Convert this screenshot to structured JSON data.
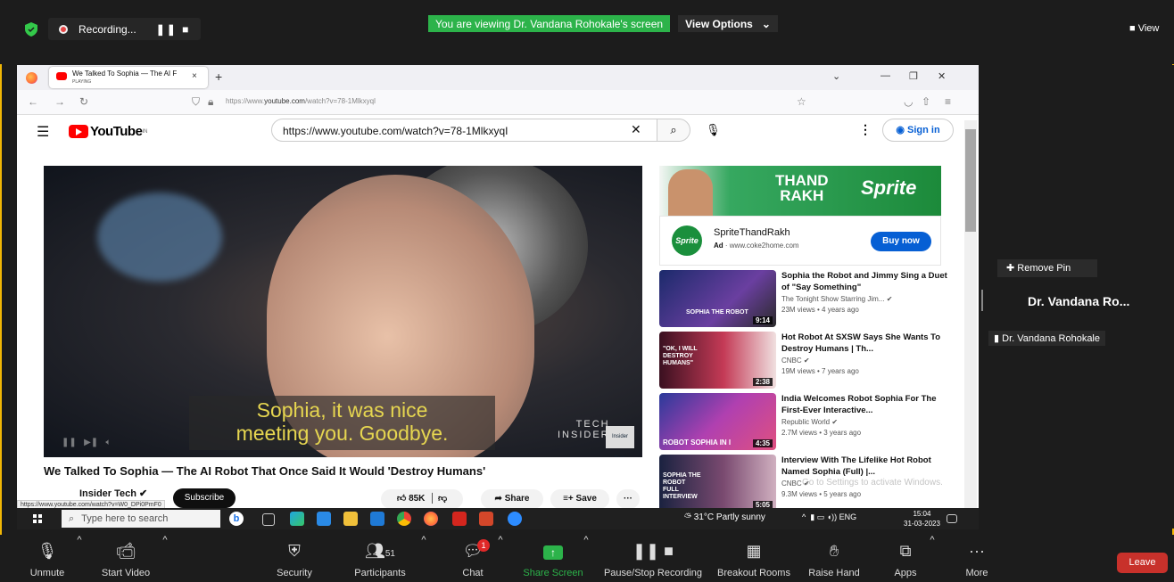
{
  "zoom_top": {
    "recording_label": "Recording...",
    "recording_controls": "❚❚  ■",
    "viewing_banner": "You are viewing Dr. Vandana Rohokale's screen",
    "view_options": "View Options",
    "view_options_caret": "⌄",
    "view_button": "View"
  },
  "browser": {
    "tab_title": "We Talked To Sophia — The AI F",
    "tab_status": "PLAYING",
    "tab_close": "×",
    "new_tab": "+",
    "url_prefix": "https://www.",
    "url_domain": "youtube.com",
    "url_path": "/watch?v=78-1Mlkxyql",
    "status_url": "https://www.youtube.com/watch?v=W0_DPi0PmF0"
  },
  "youtube": {
    "logo_text": "YouTube",
    "logo_region": "IN",
    "search_value": "https://www.youtube.com/watch?v=78-1MlkxyqI",
    "sign_in": "Sign in",
    "caption_line1": "Sophia, it was nice",
    "caption_line2": "meeting you. Goodbye.",
    "tech_insider": "TECH\nINSIDER",
    "insider_logo": "Insider Tech",
    "video_title": "We Talked To Sophia — The AI Robot That Once Said It Would 'Destroy Humans'",
    "channel_name": "Insider Tech",
    "subscribe": "Subscribe",
    "likes": "85K",
    "share": "Share",
    "save": "Save",
    "more": "···"
  },
  "ad": {
    "banner_line1": "THAND",
    "banner_line2": "RAKH",
    "banner_brand": "Sprite",
    "logo": "Sprite",
    "name": "SpriteThandRakh",
    "ad_label": "Ad",
    "url": "www.coke2home.com",
    "cta": "Buy now"
  },
  "recommendations": [
    {
      "title": "Sophia the Robot and Jimmy Sing a Duet of \"Say Something\"",
      "channel": "The Tonight Show Starring Jim...",
      "meta": "23M views • 4 years ago",
      "duration": "9:14",
      "thumb_text": "SOPHIA THE ROBOT"
    },
    {
      "title": "Hot Robot At SXSW Says She Wants To Destroy Humans | Th...",
      "channel": "CNBC",
      "meta": "19M views • 7 years ago",
      "duration": "2:38",
      "thumb_text": "\"OK, I WILL DESTROY HUMANS\""
    },
    {
      "title": "India Welcomes Robot Sophia For The First-Ever Interactive...",
      "channel": "Republic World",
      "meta": "2.7M views • 3 years ago",
      "duration": "4:35",
      "thumb_text": "ROBOT SOPHIA IN I"
    },
    {
      "title": "Interview With The Lifelike Hot Robot Named Sophia (Full) |...",
      "channel": "CNBC",
      "meta": "9.3M views • 5 years ago",
      "duration": "5:05",
      "thumb_text": "SOPHIA THE ROBOT FULL INTERVIEW"
    }
  ],
  "watermark": "Go to Settings to activate Windows.",
  "taskbar": {
    "search_placeholder": "Type here to search",
    "weather": "31°C  Partly sunny",
    "tray": "ENG",
    "time": "15:04",
    "date": "31-03-2023"
  },
  "right_panel": {
    "remove_pin": "Remove Pin",
    "participant_name": "Dr. Vandana Ro...",
    "participant_tag": "Dr. Vandana Rohokale"
  },
  "zoom_bar": {
    "unmute": "Unmute",
    "start_video": "Start Video",
    "security": "Security",
    "participants": "Participants",
    "participants_count": "51",
    "chat": "Chat",
    "chat_badge": "1",
    "share_screen": "Share Screen",
    "pause_recording": "Pause/Stop Recording",
    "breakout_rooms": "Breakout Rooms",
    "raise_hand": "Raise Hand",
    "apps": "Apps",
    "more": "More",
    "leave": "Leave"
  },
  "colors": {
    "frame": "#f2b705",
    "zoom_green": "#2cb34a",
    "leave_red": "#c8312b",
    "yt_red": "#ff0000",
    "link_blue": "#065fd4"
  }
}
